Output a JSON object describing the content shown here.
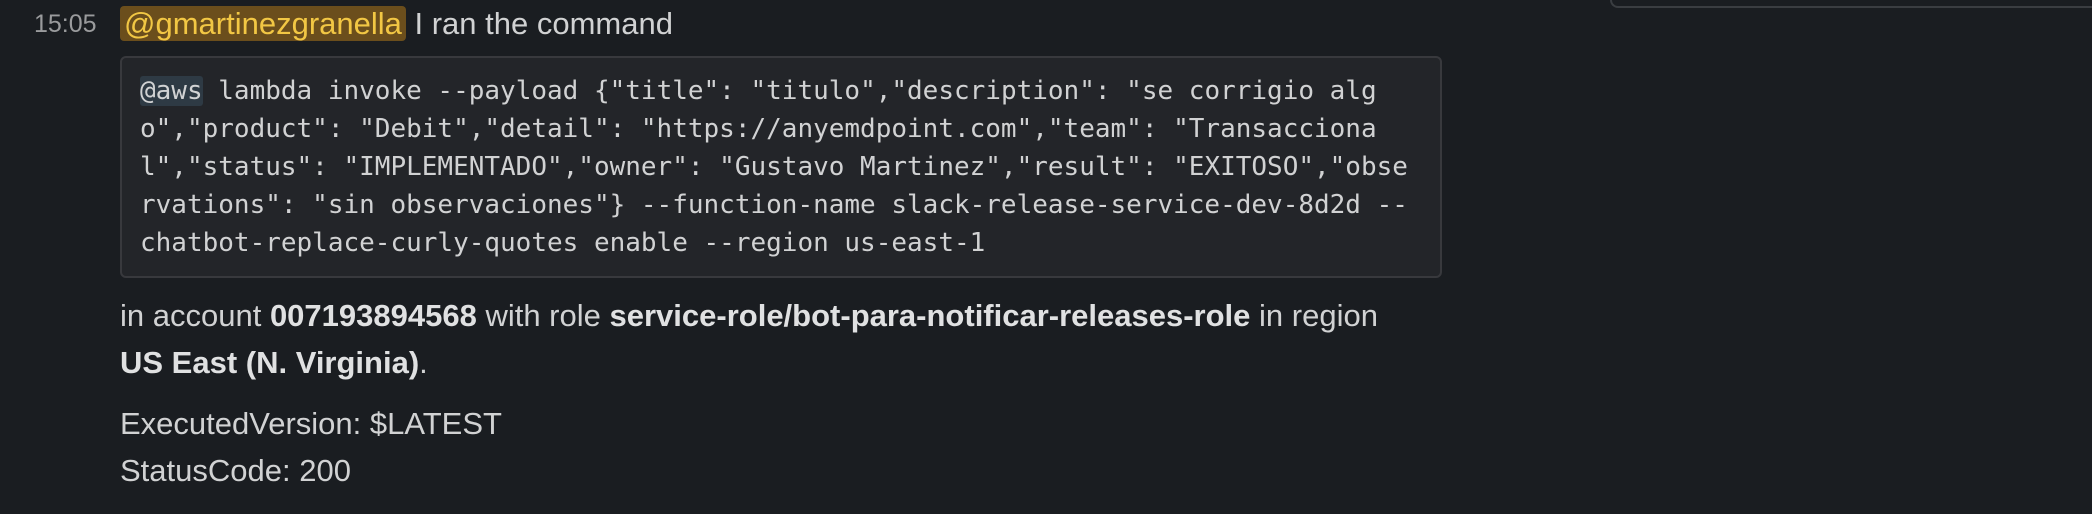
{
  "message": {
    "timestamp": "15:05",
    "mention": "@gmartinezgranella",
    "intro_text": " I ran the command",
    "code_mention": "@aws",
    "code_text": " lambda invoke --payload {\"title\": \"titulo\",\"description\": \"se corrigio algo\",\"product\": \"Debit\",\"detail\": \"https://anyemdpoint.com\",\"team\": \"Transaccional\",\"status\": \"IMPLEMENTADO\",\"owner\": \"Gustavo Martinez\",\"result\": \"EXITOSO\",\"observations\": \"sin observaciones\"} --function-name slack-release-service-dev-8d2d --chatbot-replace-curly-quotes enable --region us-east-1",
    "result": {
      "part1": "in account ",
      "account": "007193894568",
      "part2": " with role ",
      "role": "service-role/bot-para-notificar-releases-role",
      "part3": " in region ",
      "region": "US East (N. Virginia)",
      "part4": "."
    },
    "executed_version": "ExecutedVersion: $LATEST",
    "status_code": "StatusCode: 200"
  },
  "colors": {
    "background": "#1a1d21",
    "mention_bg": "#6b4e1c",
    "mention_text": "#f2c744",
    "code_bg": "#232529"
  }
}
